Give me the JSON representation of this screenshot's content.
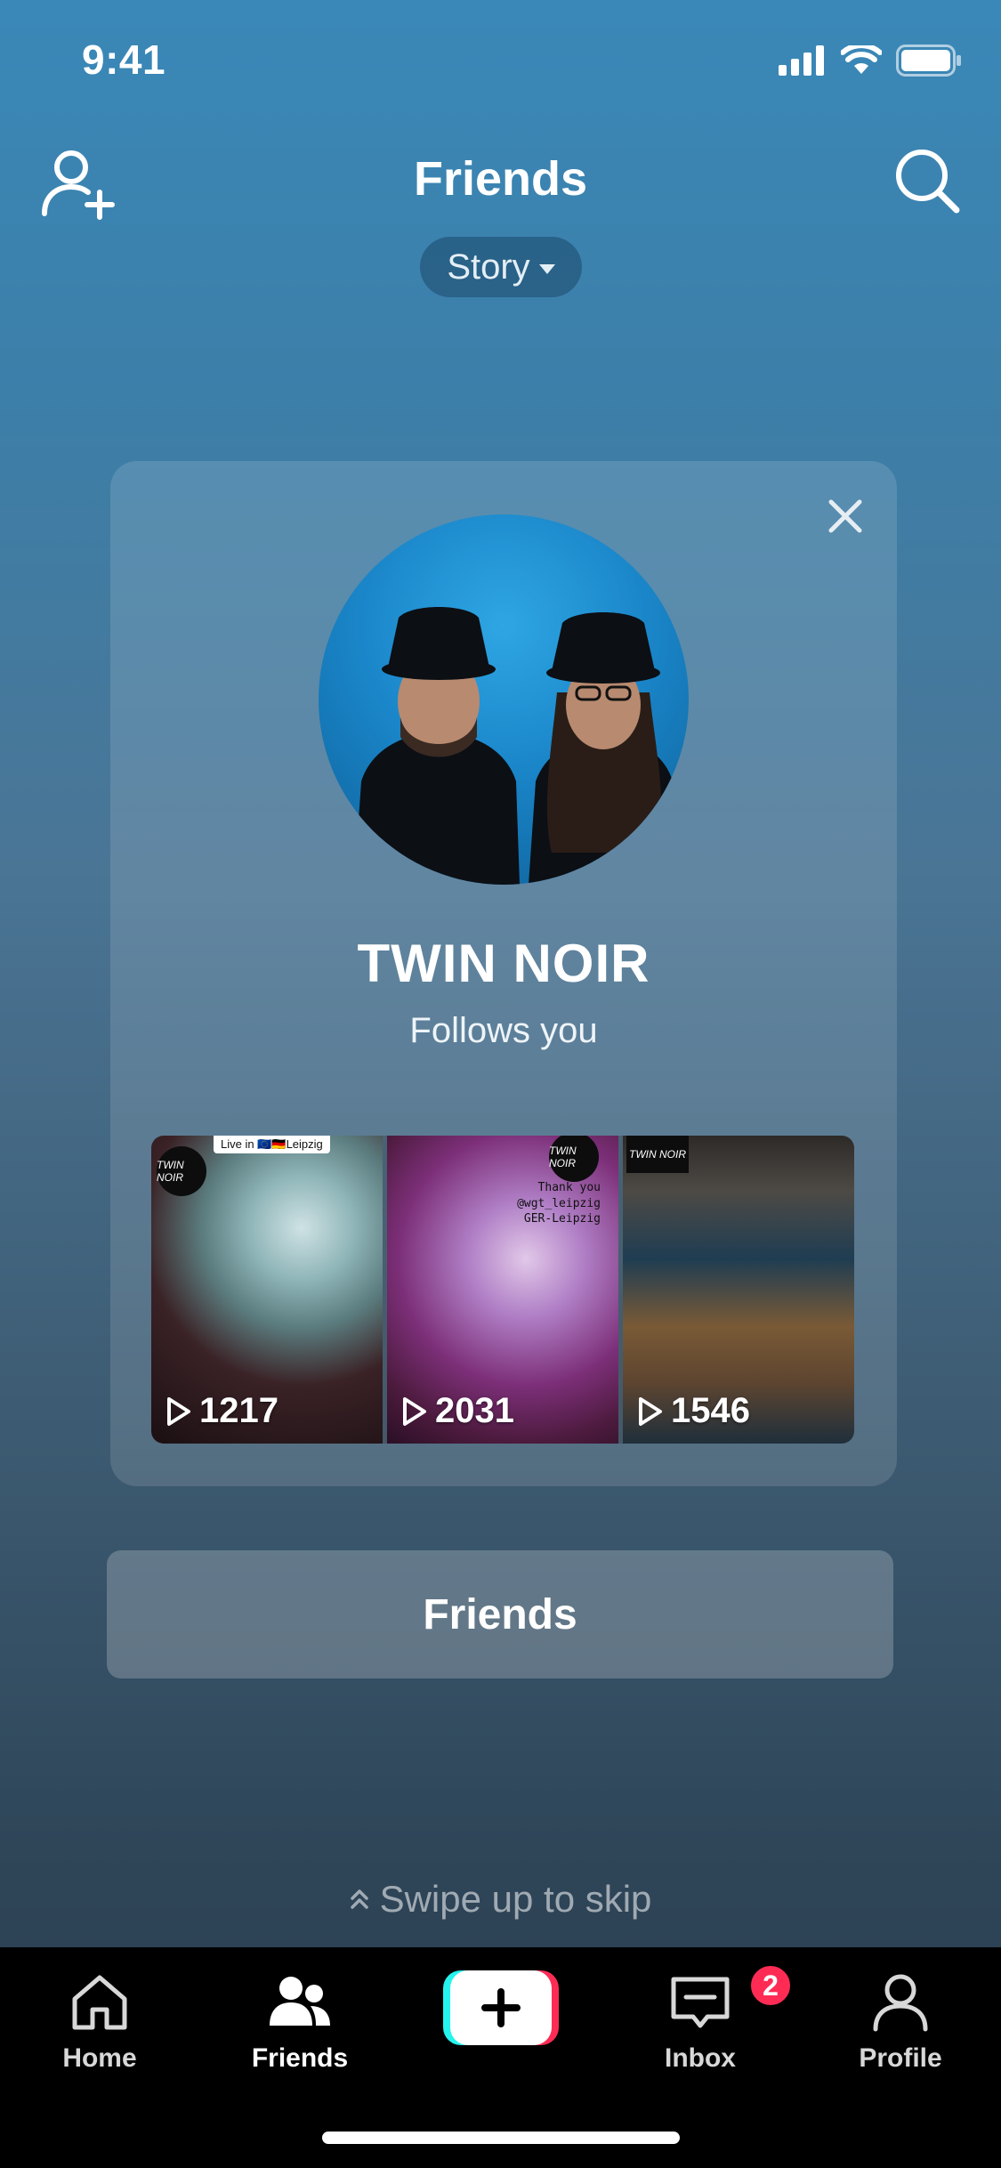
{
  "status_bar": {
    "time": "9:41"
  },
  "header": {
    "title": "Friends",
    "filter_label": "Story"
  },
  "suggestion_card": {
    "name": "TWIN NOIR",
    "subtitle": "Follows you",
    "videos": [
      {
        "views": "1217",
        "tag": "Live in 🇪🇺🇩🇪Leipzig",
        "badge": "TWIN NOIR"
      },
      {
        "views": "2031",
        "caption_lines": [
          "Thank you",
          "@wgt_leipzig",
          "GER-Leipzig"
        ],
        "badge": "TWIN NOIR"
      },
      {
        "views": "1546",
        "badge": "TWIN NOIR"
      }
    ]
  },
  "actions": {
    "friends_button_label": "Friends"
  },
  "swipe_hint": "Swipe up to skip",
  "bottom_nav": {
    "items": [
      {
        "label": "Home",
        "icon": "home-icon"
      },
      {
        "label": "Friends",
        "icon": "friends-icon",
        "active": true
      },
      {
        "label": "",
        "icon": "create-plus-icon"
      },
      {
        "label": "Inbox",
        "icon": "inbox-icon",
        "badge": "2"
      },
      {
        "label": "Profile",
        "icon": "profile-icon"
      }
    ]
  },
  "colors": {
    "accent_red": "#fe2c55",
    "accent_cyan": "#25f4ee"
  }
}
